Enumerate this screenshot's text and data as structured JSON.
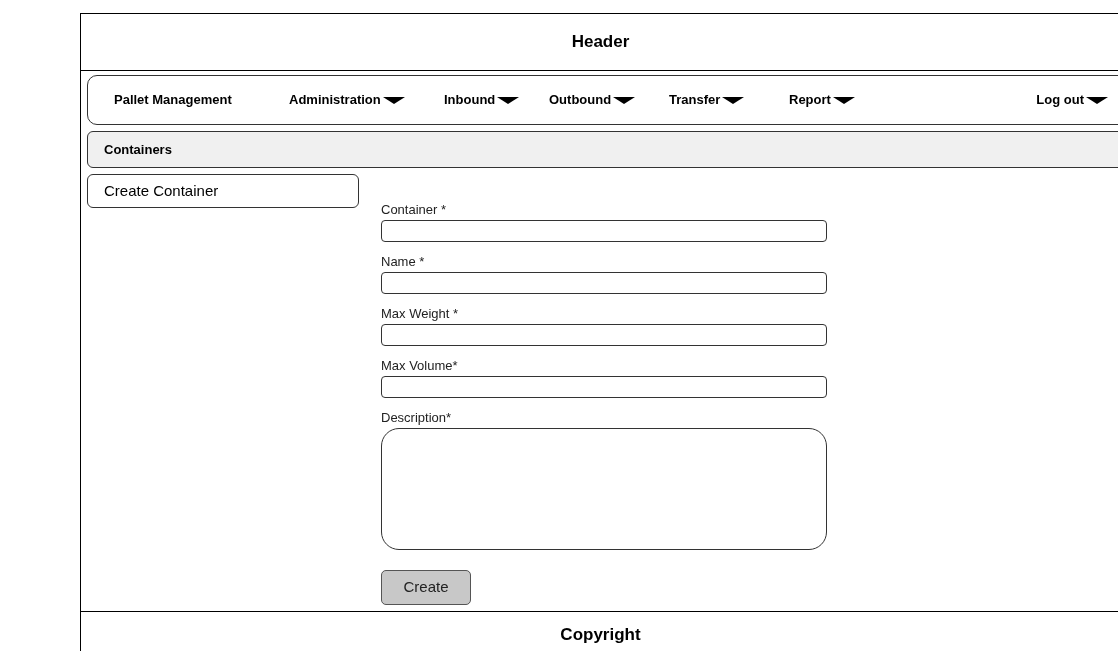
{
  "header": {
    "title": "Header"
  },
  "nav": {
    "items": [
      {
        "label": "Pallet Management",
        "dropdown": false
      },
      {
        "label": "Administration",
        "dropdown": true
      },
      {
        "label": "Inbound",
        "dropdown": true
      },
      {
        "label": "Outbound",
        "dropdown": true
      },
      {
        "label": "Transfer",
        "dropdown": true
      },
      {
        "label": "Report",
        "dropdown": true
      }
    ],
    "logout": {
      "label": "Log out",
      "dropdown": true
    }
  },
  "section": {
    "title": "Containers"
  },
  "sidebar": {
    "items": [
      {
        "label": "Create Container"
      }
    ]
  },
  "form": {
    "fields": [
      {
        "label": "Container *",
        "kind": "input"
      },
      {
        "label": "Name *",
        "kind": "input"
      },
      {
        "label": "Max Weight *",
        "kind": "input"
      },
      {
        "label": "Max Volume*",
        "kind": "input"
      },
      {
        "label": "Description*",
        "kind": "textarea"
      }
    ],
    "submit": "Create"
  },
  "footer": {
    "text": "Copyright"
  }
}
